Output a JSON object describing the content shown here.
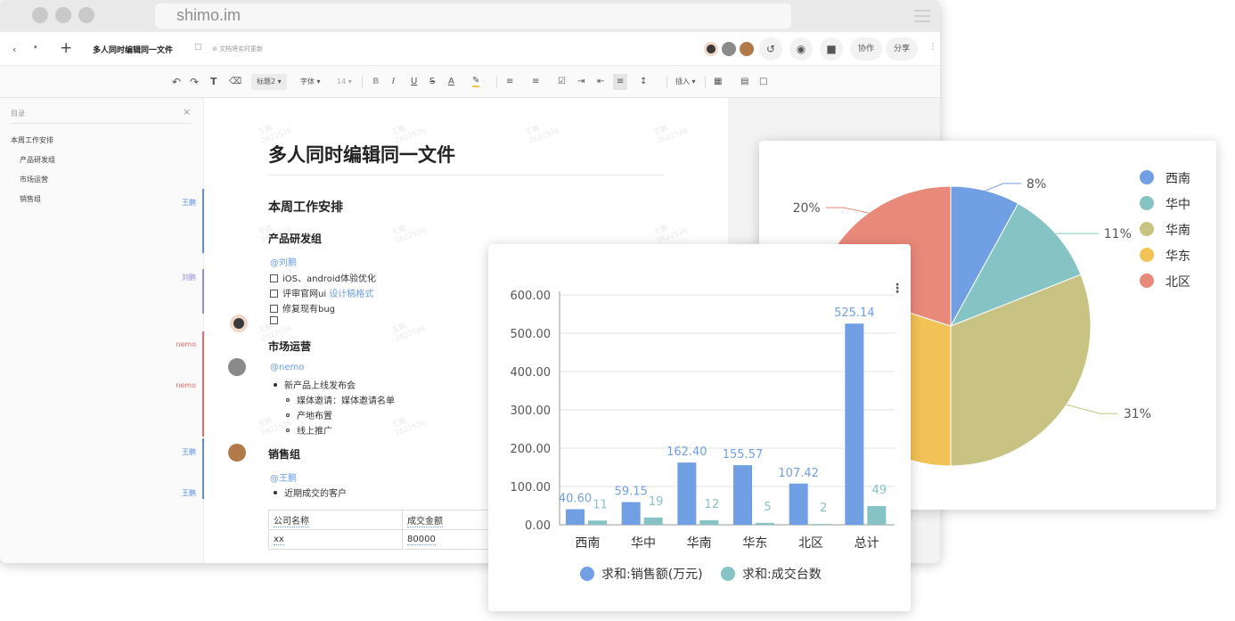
{
  "browser": {
    "url": "shimo.im"
  },
  "topbar": {
    "doc_title": "多人同时编辑同一文件",
    "save_status": "⊘ 文档将实时更新",
    "collab_label": "协作",
    "share_label": "分享",
    "history_icon": "history-icon",
    "present_icon": "play-circle-icon",
    "video_icon": "video-camera-icon"
  },
  "format_toolbar": {
    "heading_style": "标题2",
    "font_family": "字体",
    "font_size": "14",
    "insert_label": "插入"
  },
  "sidebar": {
    "title": "目录",
    "items": [
      {
        "label": "本周工作安排",
        "level": 1
      },
      {
        "label": "产品研发组",
        "level": 2
      },
      {
        "label": "市场运营",
        "level": 2
      },
      {
        "label": "销售组",
        "level": 2
      }
    ]
  },
  "gutter": {
    "authors": [
      {
        "name": "王鹏",
        "color": "#5b8fe0"
      },
      {
        "name": "刘鹏",
        "color": "#9b8ad8"
      },
      {
        "name": "nemo",
        "color": "#e06b6b"
      },
      {
        "name": "nemo",
        "color": "#e06b6b"
      },
      {
        "name": "王鹏",
        "color": "#5b8fe0"
      },
      {
        "name": "王鹏",
        "color": "#5b8fe0"
      }
    ],
    "watermark_name": "王鹏",
    "watermark_id": "2622526"
  },
  "doc": {
    "title": "多人同时编辑同一文件",
    "h_week": "本周工作安排",
    "product": {
      "heading": "产品研发组",
      "mention": "@刘鹏",
      "tasks": [
        "iOS、android体验优化",
        "评审官网ui",
        "修复现有bug",
        ""
      ],
      "link_text": "设计稿格式"
    },
    "market": {
      "heading": "市场运营",
      "mention": "@nemo",
      "bullet": "新产品上线发布会",
      "sub": [
        "媒体邀请：媒体邀请名单",
        "产地布置",
        "线上推广"
      ]
    },
    "sales": {
      "heading": "销售组",
      "mention": "@王鹏",
      "bullet": "近期成交的客户",
      "table_headers": [
        "公司名称",
        "成交金额"
      ],
      "table_rows": [
        [
          "xx",
          "80000"
        ]
      ]
    }
  },
  "chart_data": [
    {
      "type": "pie",
      "categories": [
        "西南",
        "华中",
        "华南",
        "华东",
        "北区"
      ],
      "values": [
        8,
        11,
        31,
        30,
        20
      ],
      "labels": [
        "8%",
        "11%",
        "31%",
        "",
        "20%"
      ],
      "colors": [
        "#719fe3",
        "#86c3c5",
        "#c8c382",
        "#f2c257",
        "#e9897a"
      ],
      "legend": "right"
    },
    {
      "type": "bar",
      "categories": [
        "西南",
        "华中",
        "华南",
        "华东",
        "北区",
        "总计"
      ],
      "series": [
        {
          "name": "求和:销售额(万元)",
          "values": [
            40.6,
            59.15,
            162.4,
            155.57,
            107.42,
            525.14
          ],
          "labels": [
            "40.60",
            "59.15",
            "162.40",
            "155.57",
            "107.42",
            "525.14"
          ],
          "color": "#719fe3"
        },
        {
          "name": "求和:成交台数",
          "values": [
            11,
            19,
            12,
            5,
            2,
            49
          ],
          "labels": [
            "11",
            "19",
            "12",
            "5",
            "2",
            "49"
          ],
          "color": "#86c3c5"
        }
      ],
      "yticks": [
        "600.00",
        "500.00",
        "400.00",
        "300.00",
        "200.00",
        "100.00",
        "0.00"
      ],
      "ylim": [
        0,
        600
      ],
      "grid": true,
      "legend": "bottom"
    }
  ]
}
